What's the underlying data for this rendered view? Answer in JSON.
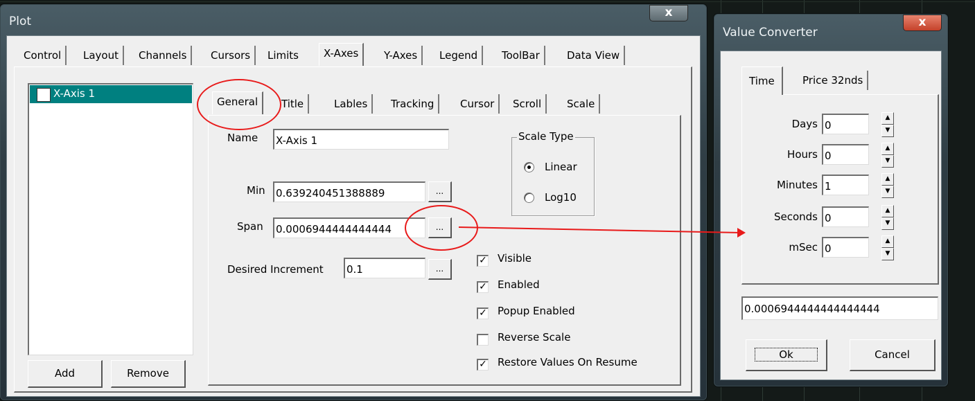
{
  "plot": {
    "title": "Plot",
    "close": "x",
    "main_tabs": [
      "Control",
      "Layout",
      "Channels",
      "Cursors",
      "Limits",
      "X-Axes",
      "Y-Axes",
      "Legend",
      "ToolBar",
      "Data View"
    ],
    "axis_list_item": "X-Axis 1",
    "add_label": "Add",
    "remove_label": "Remove",
    "sub_tabs": [
      "General",
      "Title",
      "Lables",
      "Tracking",
      "Cursor",
      "Scroll",
      "Scale"
    ],
    "name_label": "Name",
    "name_value": "X-Axis 1",
    "min_label": "Min",
    "min_value": "0.639240451388889",
    "span_label": "Span",
    "span_value": "0.0006944444444444",
    "desired_increment_label": "Desired Increment",
    "desired_increment_value": "0.1",
    "ellipsis": "...",
    "scale_type_label": "Scale Type",
    "linear_label": "Linear",
    "log10_label": "Log10",
    "checkboxes": [
      {
        "label": "Visible",
        "checked": true
      },
      {
        "label": "Enabled",
        "checked": true
      },
      {
        "label": "Popup Enabled",
        "checked": true
      },
      {
        "label": "Reverse Scale",
        "checked": false
      },
      {
        "label": "Restore Values On Resume",
        "checked": true
      }
    ]
  },
  "converter": {
    "title": "Value Converter",
    "close": "x",
    "tabs": [
      "Time",
      "Price 32nds"
    ],
    "fields": [
      {
        "label": "Days",
        "value": "0"
      },
      {
        "label": "Hours",
        "value": "0"
      },
      {
        "label": "Minutes",
        "value": "1"
      },
      {
        "label": "Seconds",
        "value": "0"
      },
      {
        "label": "mSec",
        "value": "0"
      }
    ],
    "result": "0.0006944444444444444",
    "ok_label": "Ok",
    "cancel_label": "Cancel"
  },
  "colors": {
    "annotation": "#e81a1a",
    "selection": "#008080"
  }
}
